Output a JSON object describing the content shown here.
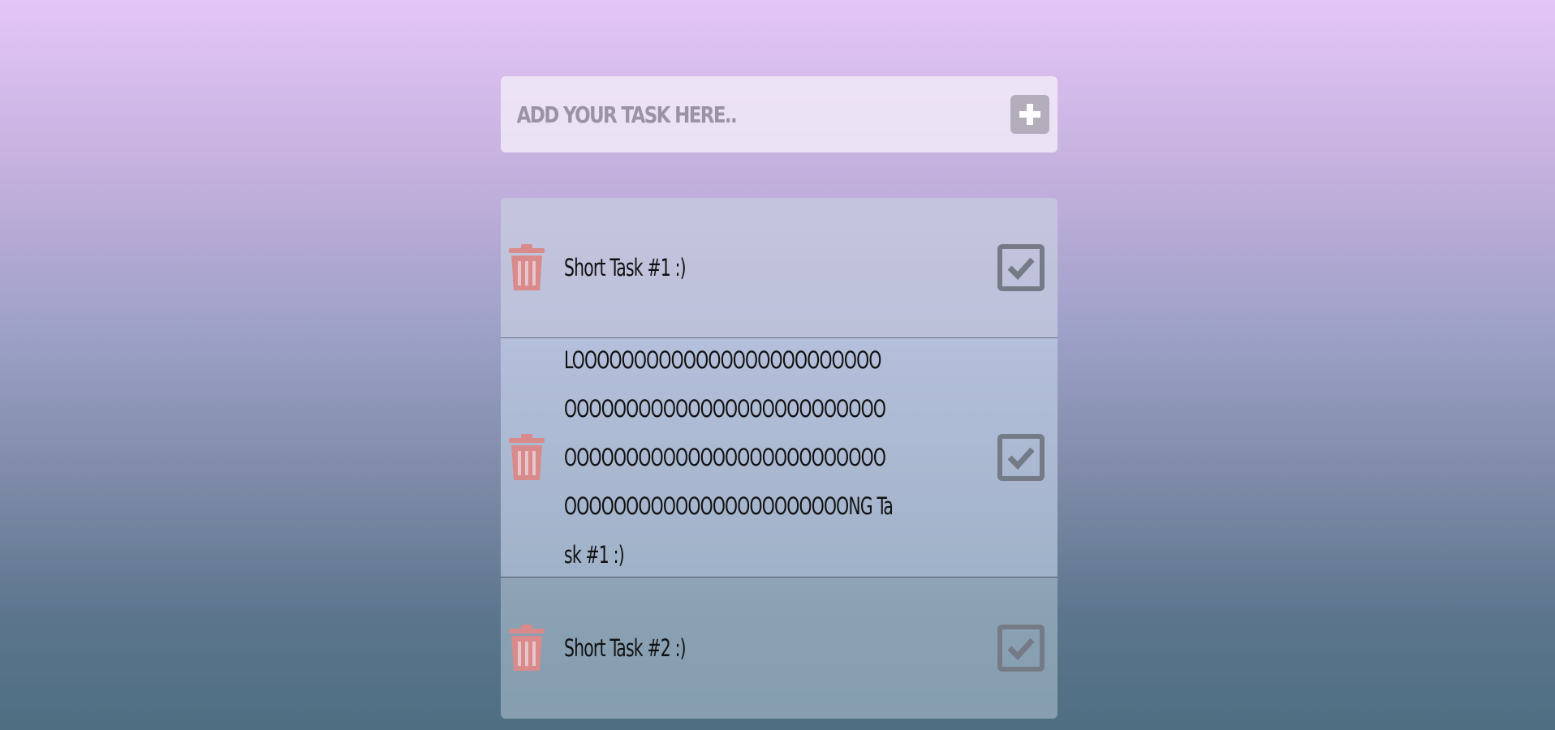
{
  "add_bar": {
    "placeholder": "ADD YOUR TASK HERE..",
    "add_icon": "plus-icon"
  },
  "tasks": [
    {
      "text": "Short Task #1 :)"
    },
    {
      "text": "LOOOOOOOOOOOOOOOOOOOOOOOOOOOOOOOOOOOOOOOOOOOOOOOOOOOOOOOOOOOOOOOOOOOOOOOOOOOOOOOOOOOOOOOOOOOOOOOOOOOONG Task #1 :)"
    },
    {
      "text": "Short Task #2 :)"
    }
  ],
  "icons": {
    "delete": "trash-icon",
    "complete": "checkbox-check-icon"
  },
  "colors": {
    "trash": "#d98a8a",
    "check": "#757b86",
    "add_button": "#b4adbb"
  }
}
